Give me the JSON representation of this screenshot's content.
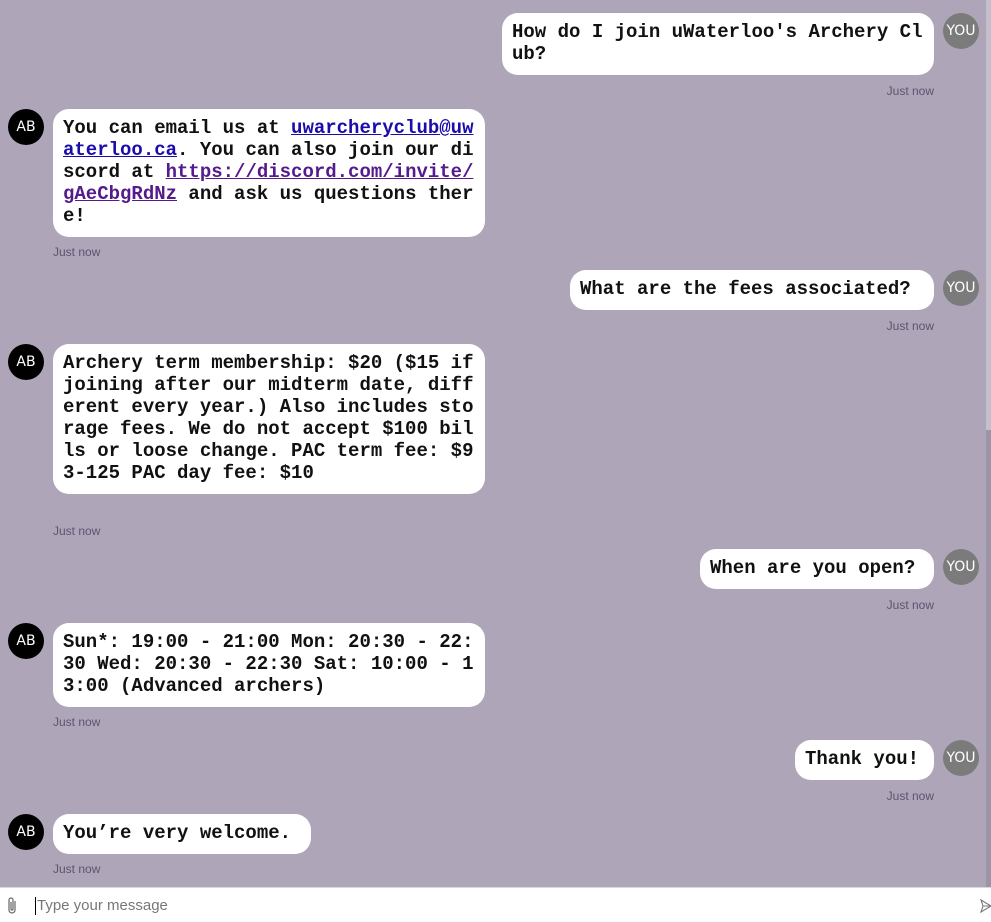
{
  "chat": {
    "messages": [
      {
        "sender": "user",
        "avatar": "YOU",
        "text": "How do I join uWaterloo's Archery Club?",
        "time": "Just now"
      },
      {
        "sender": "bot",
        "avatar": "AB",
        "text_before": "You can email us at ",
        "email": "uwarcheryclub@uwaterloo.ca",
        "text_middle": ". You can also join our discord at ",
        "link": "https://discord.com/invite/gAeCbgRdNz",
        "text_after": " and ask us questions there!",
        "time": "Just now"
      },
      {
        "sender": "user",
        "avatar": "YOU",
        "text": "What are the fees associated?",
        "time": "Just now"
      },
      {
        "sender": "bot",
        "avatar": "AB",
        "text": "Archery term membership: $20 ($15 if joining after our midterm date, different every year.) Also includes storage fees. We do not accept $100 bills or loose change. PAC term fee: $93-125 PAC day fee: $10",
        "time": "Just now"
      },
      {
        "sender": "user",
        "avatar": "YOU",
        "text": "When are you open?",
        "time": "Just now"
      },
      {
        "sender": "bot",
        "avatar": "AB",
        "text": "Sun*: 19:00 - 21:00 Mon: 20:30 - 22:30 Wed: 20:30 - 22:30 Sat: 10:00 - 13:00 (Advanced archers)",
        "time": "Just now"
      },
      {
        "sender": "user",
        "avatar": "YOU",
        "text": "Thank you!",
        "time": "Just now"
      },
      {
        "sender": "bot",
        "avatar": "AB",
        "text": "You’re very welcome.",
        "time": "Just now"
      }
    ]
  },
  "composer": {
    "placeholder": "Type your message",
    "attach_icon": "paperclip-icon",
    "send_icon": "send-icon"
  },
  "colors": {
    "background": "#aea6b8",
    "bubble": "#ffffff",
    "bot_avatar": "#000000",
    "user_avatar": "#7b7b7b",
    "link": "#1a0dab",
    "visited_link": "#551a8b"
  }
}
